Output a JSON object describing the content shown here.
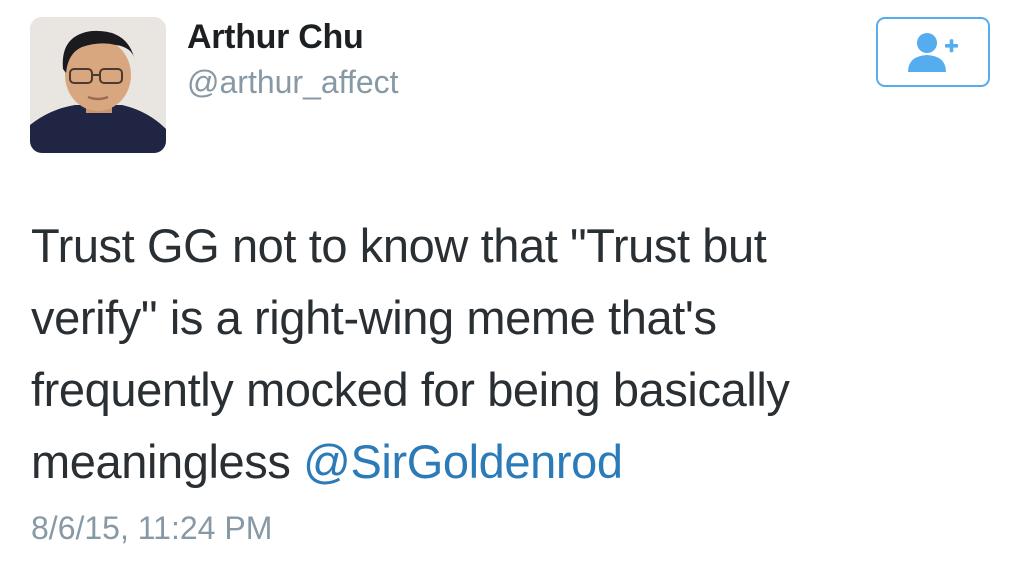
{
  "user": {
    "display_name": "Arthur Chu",
    "handle": "@arthur_affect"
  },
  "follow_button": {
    "icon": "add-user-icon"
  },
  "tweet": {
    "lines": [
      "Trust GG not to know that \"Trust but",
      "verify\" is a right-wing meme that's",
      "frequently mocked for being basically",
      "meaningless "
    ],
    "mention": "@SirGoldenrod",
    "timestamp": "8/6/15, 11:24 PM"
  },
  "colors": {
    "text": "#292f33",
    "secondary": "#8899a6",
    "link": "#2b7bb9",
    "accent": "#55acee"
  }
}
